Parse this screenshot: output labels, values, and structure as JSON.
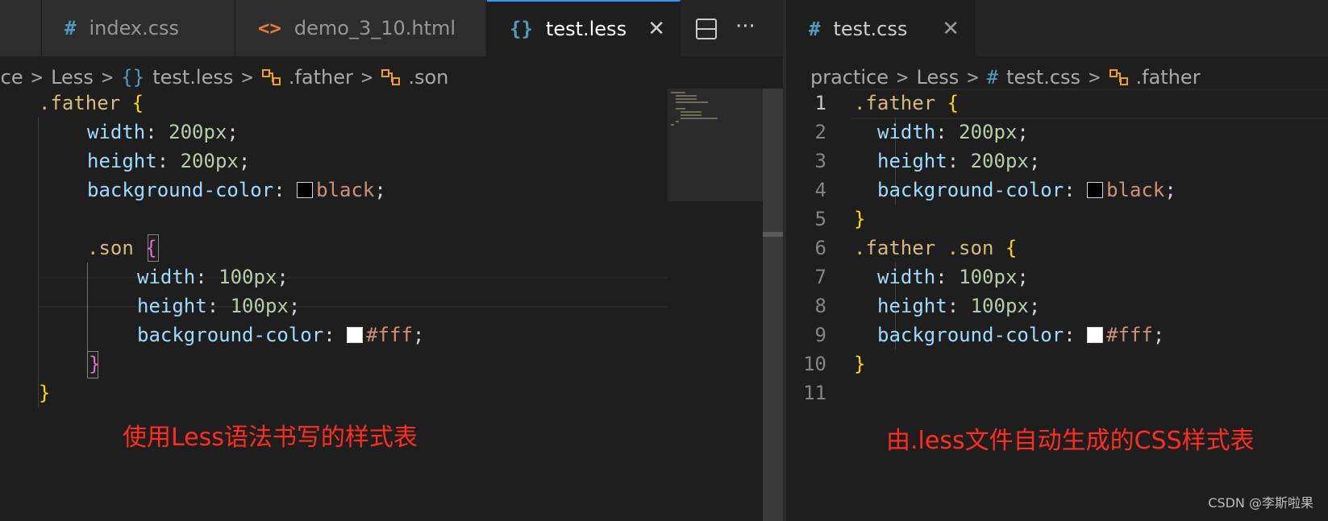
{
  "left": {
    "tabs": [
      {
        "icon": "#",
        "label": "index.css"
      },
      {
        "icon": "<>",
        "label": "demo_3_10.html"
      },
      {
        "icon": "{}",
        "label": "test.less",
        "close": "✕"
      }
    ],
    "actions": {
      "split": "split-editor",
      "more": "···"
    },
    "breadcrumb": [
      {
        "label": "ice"
      },
      {
        "label": "Less"
      },
      {
        "icon": "{}",
        "label": "test.less"
      },
      {
        "label": ".father"
      },
      {
        "label": ".son"
      }
    ],
    "code": [
      {
        "sel": ".father",
        "brace": "{"
      },
      {
        "prop": "width",
        "num": "200px"
      },
      {
        "prop": "height",
        "num": "200px"
      },
      {
        "prop": "background-color",
        "swatch": "#000000",
        "val": "black"
      },
      {},
      {
        "sel": ".son",
        "brace": "{"
      },
      {
        "prop": "width",
        "num": "100px"
      },
      {
        "prop": "height",
        "num": "100px"
      },
      {
        "prop": "background-color",
        "swatch": "#ffffff",
        "val": "#fff"
      },
      {
        "brace": "}"
      },
      {
        "brace": "}"
      }
    ],
    "note": "使用Less语法书写的样式表"
  },
  "right": {
    "tabs": [
      {
        "icon": "#",
        "label": "test.css",
        "close": "✕"
      }
    ],
    "breadcrumb": [
      {
        "label": "practice"
      },
      {
        "label": "Less"
      },
      {
        "icon": "#",
        "label": "test.css"
      },
      {
        "label": ".father"
      }
    ],
    "line_numbers": [
      "1",
      "2",
      "3",
      "4",
      "5",
      "6",
      "7",
      "8",
      "9",
      "10",
      "11"
    ],
    "code": [
      {
        "sel": ".father",
        "brace": "{"
      },
      {
        "prop": "width",
        "num": "200px"
      },
      {
        "prop": "height",
        "num": "200px"
      },
      {
        "prop": "background-color",
        "swatch": "#000000",
        "val": "black"
      },
      {
        "brace": "}"
      },
      {
        "sel": ".father .son",
        "brace": "{"
      },
      {
        "prop": "width",
        "num": "100px"
      },
      {
        "prop": "height",
        "num": "100px"
      },
      {
        "prop": "background-color",
        "swatch": "#ffffff",
        "val": "#fff"
      },
      {
        "brace": "}"
      },
      {}
    ],
    "note": "由.less文件自动生成的CSS样式表"
  },
  "watermark": "CSDN @李斯啦果",
  "colors": {
    "note": "#ff2d20",
    "accent": "#3794ff"
  }
}
